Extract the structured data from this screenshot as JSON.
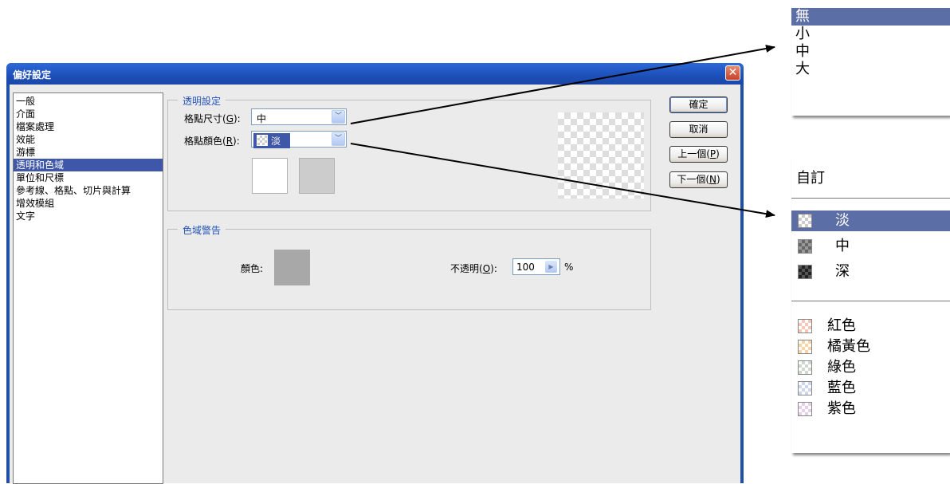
{
  "dialog": {
    "title": "偏好設定",
    "close_icon": "close-icon"
  },
  "sidebar": {
    "items": [
      {
        "label": "一般",
        "selected": false
      },
      {
        "label": "介面",
        "selected": false
      },
      {
        "label": "檔案處理",
        "selected": false
      },
      {
        "label": "效能",
        "selected": false
      },
      {
        "label": "游標",
        "selected": false
      },
      {
        "label": "透明和色域",
        "selected": true
      },
      {
        "label": "單位和尺標",
        "selected": false
      },
      {
        "label": "參考線、格點、切片與計算",
        "selected": false
      },
      {
        "label": "增效模組",
        "selected": false
      },
      {
        "label": "文字",
        "selected": false
      }
    ]
  },
  "transparency": {
    "legend": "透明設定",
    "grid_size_label_pre": "格點尺寸(",
    "grid_size_hotkey": "G",
    "grid_size_label_post": "):",
    "grid_size_value": "中",
    "grid_color_label_pre": "格點顏色(",
    "grid_color_hotkey": "R",
    "grid_color_label_post": "):",
    "grid_color_value": "淡"
  },
  "gamut": {
    "legend": "色域警告",
    "color_label": "顏色:",
    "opacity_label_pre": "不透明(",
    "opacity_hotkey": "O",
    "opacity_label_post": "):",
    "opacity_value": "100",
    "opacity_unit": "%"
  },
  "buttons": {
    "ok": "確定",
    "cancel": "取消",
    "prev_pre": "上一個(",
    "prev_hotkey": "P",
    "prev_post": ")",
    "next_pre": "下一個(",
    "next_hotkey": "N",
    "next_post": ")"
  },
  "grid_size_menu": {
    "items": [
      {
        "label": "無",
        "highlighted": true
      },
      {
        "label": "小",
        "highlighted": false
      },
      {
        "label": "中",
        "highlighted": false
      },
      {
        "label": "大",
        "highlighted": false
      }
    ]
  },
  "grid_color_menu": {
    "custom": "自訂",
    "gray_items": [
      {
        "label": "淡",
        "highlighted": true
      },
      {
        "label": "中",
        "highlighted": false
      },
      {
        "label": "深",
        "highlighted": false
      }
    ],
    "color_items": [
      {
        "label": "紅色"
      },
      {
        "label": "橘黃色"
      },
      {
        "label": "綠色"
      },
      {
        "label": "藍色"
      },
      {
        "label": "紫色"
      }
    ]
  },
  "colors": {
    "accent": "#3f57a8",
    "menu_highlight": "#5c6ea6",
    "title_bar": "#1f4fa8",
    "gamut_swatch": "#a8a8a8",
    "grid_swatch_1": "#ffffff",
    "grid_swatch_2": "#cccccc"
  }
}
